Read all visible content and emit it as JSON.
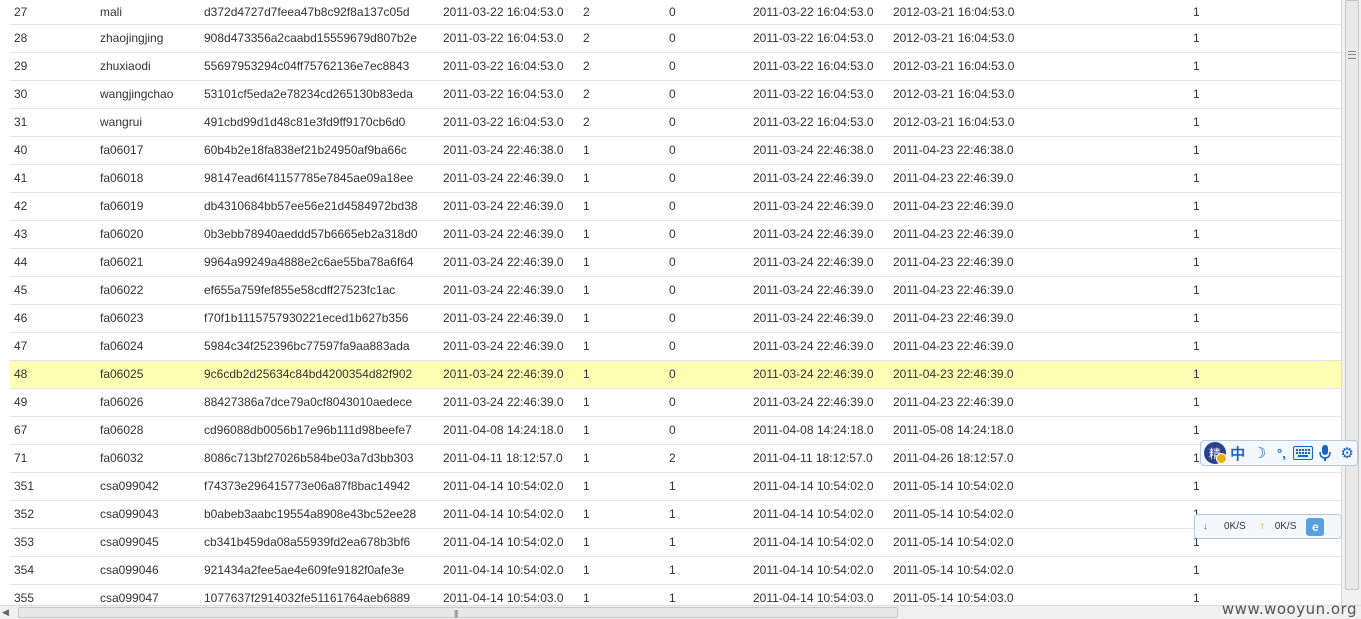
{
  "rows": [
    [
      "27",
      "mali",
      "d372d4727d7feea47b8c92f8a137c05d",
      "2011-03-22 16:04:53.0",
      "2",
      "0",
      "2011-03-22 16:04:53.0",
      "2012-03-21 16:04:53.0",
      "1"
    ],
    [
      "28",
      "zhaojingjing",
      "908d473356a2caabd15559679d807b2e",
      "2011-03-22 16:04:53.0",
      "2",
      "0",
      "2011-03-22 16:04:53.0",
      "2012-03-21 16:04:53.0",
      "1"
    ],
    [
      "29",
      "zhuxiaodi",
      "55697953294c04ff75762136e7ec8843",
      "2011-03-22 16:04:53.0",
      "2",
      "0",
      "2011-03-22 16:04:53.0",
      "2012-03-21 16:04:53.0",
      "1"
    ],
    [
      "30",
      "wangjingchao",
      "53101cf5eda2e78234cd265130b83eda",
      "2011-03-22 16:04:53.0",
      "2",
      "0",
      "2011-03-22 16:04:53.0",
      "2012-03-21 16:04:53.0",
      "1"
    ],
    [
      "31",
      "wangrui",
      "491cbd99d1d48c81e3fd9ff9170cb6d0",
      "2011-03-22 16:04:53.0",
      "2",
      "0",
      "2011-03-22 16:04:53.0",
      "2012-03-21 16:04:53.0",
      "1"
    ],
    [
      "40",
      "fa06017",
      "60b4b2e18fa838ef21b24950af9ba66c",
      "2011-03-24 22:46:38.0",
      "1",
      "0",
      "2011-03-24 22:46:38.0",
      "2011-04-23 22:46:38.0",
      "1"
    ],
    [
      "41",
      "fa06018",
      "98147ead6f41157785e7845ae09a18ee",
      "2011-03-24 22:46:39.0",
      "1",
      "0",
      "2011-03-24 22:46:39.0",
      "2011-04-23 22:46:39.0",
      "1"
    ],
    [
      "42",
      "fa06019",
      "db4310684bb57ee56e21d4584972bd38",
      "2011-03-24 22:46:39.0",
      "1",
      "0",
      "2011-03-24 22:46:39.0",
      "2011-04-23 22:46:39.0",
      "1"
    ],
    [
      "43",
      "fa06020",
      "0b3ebb78940aeddd57b6665eb2a318d0",
      "2011-03-24 22:46:39.0",
      "1",
      "0",
      "2011-03-24 22:46:39.0",
      "2011-04-23 22:46:39.0",
      "1"
    ],
    [
      "44",
      "fa06021",
      "9964a99249a4888e2c6ae55ba78a6f64",
      "2011-03-24 22:46:39.0",
      "1",
      "0",
      "2011-03-24 22:46:39.0",
      "2011-04-23 22:46:39.0",
      "1"
    ],
    [
      "45",
      "fa06022",
      "ef655a759fef855e58cdff27523fc1ac",
      "2011-03-24 22:46:39.0",
      "1",
      "0",
      "2011-03-24 22:46:39.0",
      "2011-04-23 22:46:39.0",
      "1"
    ],
    [
      "46",
      "fa06023",
      "f70f1b1115757930221eced1b627b356",
      "2011-03-24 22:46:39.0",
      "1",
      "0",
      "2011-03-24 22:46:39.0",
      "2011-04-23 22:46:39.0",
      "1"
    ],
    [
      "47",
      "fa06024",
      "5984c34f252396bc77597fa9aa883ada",
      "2011-03-24 22:46:39.0",
      "1",
      "0",
      "2011-03-24 22:46:39.0",
      "2011-04-23 22:46:39.0",
      "1"
    ],
    [
      "48",
      "fa06025",
      "9c6cdb2d25634c84bd4200354d82f902",
      "2011-03-24 22:46:39.0",
      "1",
      "0",
      "2011-03-24 22:46:39.0",
      "2011-04-23 22:46:39.0",
      "1"
    ],
    [
      "49",
      "fa06026",
      "88427386a7dce79a0cf8043010aedece",
      "2011-03-24 22:46:39.0",
      "1",
      "0",
      "2011-03-24 22:46:39.0",
      "2011-04-23 22:46:39.0",
      "1"
    ],
    [
      "67",
      "fa06028",
      "cd96088db0056b17e96b111d98beefe7",
      "2011-04-08 14:24:18.0",
      "1",
      "0",
      "2011-04-08 14:24:18.0",
      "2011-05-08 14:24:18.0",
      "1"
    ],
    [
      "71",
      "fa06032",
      "8086c713bf27026b584be03a7d3bb303",
      "2011-04-11 18:12:57.0",
      "1",
      "2",
      "2011-04-11 18:12:57.0",
      "2011-04-26 18:12:57.0",
      "1"
    ],
    [
      "351",
      "csa099042",
      "f74373e296415773e06a87f8bac14942",
      "2011-04-14 10:54:02.0",
      "1",
      "1",
      "2011-04-14 10:54:02.0",
      "2011-05-14 10:54:02.0",
      "1"
    ],
    [
      "352",
      "csa099043",
      "b0abeb3aabc19554a8908e43bc52ee28",
      "2011-04-14 10:54:02.0",
      "1",
      "1",
      "2011-04-14 10:54:02.0",
      "2011-05-14 10:54:02.0",
      "1"
    ],
    [
      "353",
      "csa099045",
      "cb341b459da08a55939fd2ea678b3bf6",
      "2011-04-14 10:54:02.0",
      "1",
      "1",
      "2011-04-14 10:54:02.0",
      "2011-05-14 10:54:02.0",
      "1"
    ],
    [
      "354",
      "csa099046",
      "921434a2fee5ae4e609fe9182f0afe3e",
      "2011-04-14 10:54:02.0",
      "1",
      "1",
      "2011-04-14 10:54:02.0",
      "2011-05-14 10:54:02.0",
      "1"
    ],
    [
      "355",
      "csa099047",
      "1077637f2914032fe51161764aeb6889",
      "2011-04-14 10:54:03.0",
      "1",
      "1",
      "2011-04-14 10:54:03.0",
      "2011-05-14 10:54:03.0",
      "1"
    ]
  ],
  "highlighted_row_index": 13,
  "colors": {
    "highlight": "#ffffb3",
    "row_border": "#e4e4e4",
    "text": "#333333"
  },
  "ime_toolbar": {
    "icons": [
      "ime-logo-icon",
      "chinese-mode-icon",
      "moon-punctuation-icon",
      "comma-icon",
      "keyboard-icon",
      "microphone-icon",
      "gear-icon"
    ],
    "logo_char": "精",
    "mode_char": "中"
  },
  "net_monitor": {
    "download_speed": "0K/S",
    "upload_speed": "0K/S"
  },
  "watermark": "www.wooyun.org"
}
